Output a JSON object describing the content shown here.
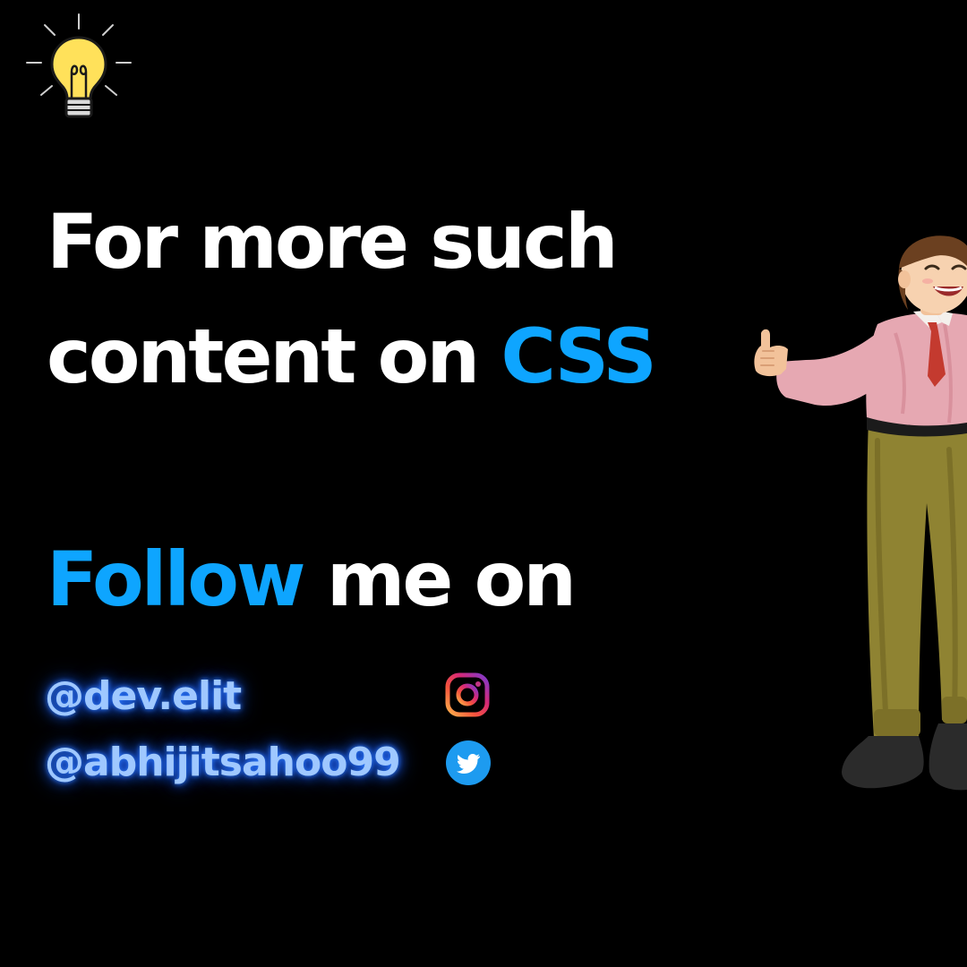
{
  "headline": {
    "line1": "For more such",
    "line2_prefix": "content on",
    "line2_accent": "CSS"
  },
  "follow": {
    "accent": "Follow",
    "rest": "me on"
  },
  "socials": [
    {
      "handle": "@dev.elit",
      "platform_icon": "instagram-icon"
    },
    {
      "handle": "@abhijitsahoo99",
      "platform_icon": "twitter-icon"
    }
  ],
  "colors": {
    "background": "#000000",
    "text": "#ffffff",
    "accent": "#0ea5ff",
    "handle_glow": "#2f7dff",
    "twitter": "#1d9bf0"
  },
  "icons": {
    "top_left": "lightbulb-icon",
    "illustration": "thumbs-up-person-illustration"
  }
}
